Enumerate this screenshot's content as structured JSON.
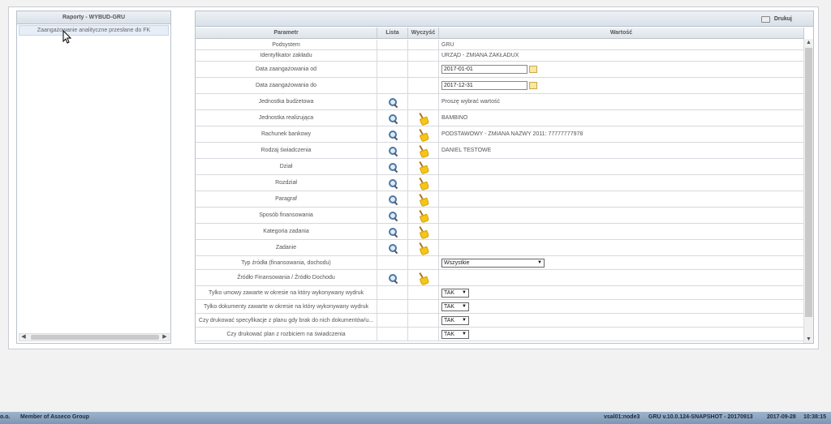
{
  "left_panel": {
    "title": "Raporty - WYBUD-GRU",
    "items": [
      "Zaangażowanie analityczne przesłane do FK"
    ],
    "scroll_left": "◀",
    "scroll_right": "▶"
  },
  "toolbar": {
    "print_label": "Drukuj",
    "print_icon": "printer-icon"
  },
  "table": {
    "headers": {
      "param": "Parametr",
      "list": "Lista",
      "clear": "Wyczyść",
      "value": "Wartość"
    },
    "rows": [
      {
        "param": "Podsystem",
        "value": "GRU",
        "type": "text"
      },
      {
        "param": "Identyfikator zakładu",
        "value": "URZĄD - ZMIANA ZAKŁADUX",
        "type": "text"
      },
      {
        "param": "Data zaangażowania od",
        "value": "2017-01-01",
        "type": "date"
      },
      {
        "param": "Data zaangażowania do",
        "value": "2017-12-31",
        "type": "date"
      },
      {
        "param": "Jednostka budżetowa",
        "value": "Proszę wybrać wartość",
        "type": "lookup_noclear"
      },
      {
        "param": "Jednostka realizująca",
        "value": "BAMBINO",
        "type": "lookup"
      },
      {
        "param": "Rachunek bankowy",
        "value": "PODSTAWOWY - ZMIANA NAZWY 2011: 77777777978",
        "type": "lookup"
      },
      {
        "param": "Rodzaj świadczenia",
        "value": "DANIEL TESTOWE",
        "type": "lookup"
      },
      {
        "param": "Dział",
        "value": "",
        "type": "lookup"
      },
      {
        "param": "Rozdział",
        "value": "",
        "type": "lookup"
      },
      {
        "param": "Paragraf",
        "value": "",
        "type": "lookup"
      },
      {
        "param": "Sposób finansowania",
        "value": "",
        "type": "lookup"
      },
      {
        "param": "Kategoria zadania",
        "value": "",
        "type": "lookup"
      },
      {
        "param": "Zadanie",
        "value": "",
        "type": "lookup"
      },
      {
        "param": "Typ źródła (finansowania, dochodu)",
        "value": "Wszystkie",
        "type": "select_wide"
      },
      {
        "param": "Źródło Finansowania / Źródło Dochodu",
        "value": "",
        "type": "lookup"
      },
      {
        "param": "Tylko umowy zawarte w okresie na który wykonywany wydruk",
        "value": "TAK",
        "type": "select"
      },
      {
        "param": "Tylko dokumenty zawarte w okresie na który wykonywany wydruk",
        "value": "TAK",
        "type": "select"
      },
      {
        "param": "Czy drukować specyfikacje z planu gdy brak do nich dokumentów/u...",
        "value": "TAK",
        "type": "select"
      },
      {
        "param": "Czy drukować plan z rozbiciem na świadczenia",
        "value": "TAK",
        "type": "select"
      }
    ]
  },
  "scrollbar": {
    "up": "▲",
    "down": "▼"
  },
  "status_bar": {
    "left_prefix": "o.o.",
    "company": "Member of Asseco Group",
    "node": "vsal01:node3",
    "version": "GRU v.10.0.124-SNAPSHOT - 20170913",
    "date": "2017-09-28",
    "time": "10:38:15"
  }
}
